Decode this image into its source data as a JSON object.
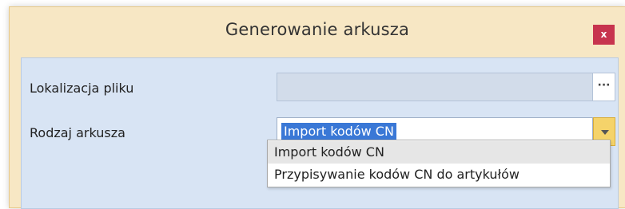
{
  "window": {
    "title": "Generowanie arkusza",
    "close_label": "x"
  },
  "form": {
    "file_location_label": "Lokalizacja pliku",
    "file_location_value": "",
    "browse_label": "···",
    "sheet_type_label": "Rodzaj arkusza",
    "sheet_type_value": "Import kodów CN"
  },
  "dropdown": {
    "options": [
      "Import kodów CN",
      "Przypisywanie kodów CN do artykułów"
    ]
  },
  "colors": {
    "frame": "#f7e7c4",
    "client_area": "#d8e4f4",
    "close_button": "#c7344e",
    "selection": "#3a78d6",
    "combo_arrow": "#f5d36a"
  }
}
